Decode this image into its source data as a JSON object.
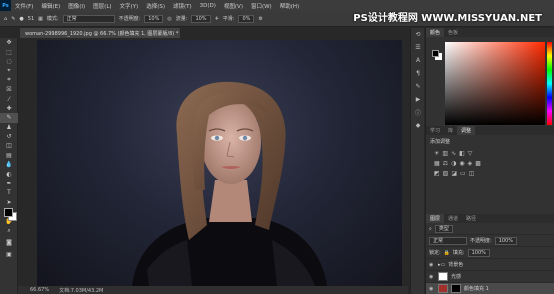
{
  "menu": {
    "logo": "Ps",
    "items": [
      "文件(F)",
      "编辑(E)",
      "图像(I)",
      "图层(L)",
      "文字(Y)",
      "选择(S)",
      "滤镜(T)",
      "3D(D)",
      "视图(V)",
      "窗口(W)",
      "帮助(H)"
    ]
  },
  "watermark": "PS设计教程网 WWW.MISSYUAN.NET",
  "options": {
    "brush_size": "51",
    "mode_label": "模式:",
    "mode_value": "正常",
    "opacity_label": "不透明度:",
    "opacity_value": "10%",
    "flow_label": "流量:",
    "flow_value": "10%",
    "smooth_label": "平滑:",
    "smooth_value": "0%"
  },
  "document": {
    "tab_title": "woman-2998996_1920.jpg @ 66.7% (颜色填充 1, 图层蒙版/8) *",
    "close": "×",
    "zoom": "66.67%",
    "doc_info": "文档:7.03M/43.2M"
  },
  "color_panel": {
    "tabs": [
      "颜色",
      "色板"
    ],
    "fg": "#000000",
    "bg": "#ffffff"
  },
  "adjust_panel": {
    "tabs": [
      "学习",
      "库",
      "调整"
    ],
    "title": "添加调整"
  },
  "layers_panel": {
    "tabs": [
      "图层",
      "通道",
      "路径"
    ],
    "filter_label": "类型",
    "blend_mode": "正常",
    "opacity_label": "不透明度:",
    "opacity_value": "100%",
    "lock_label": "锁定:",
    "fill_label": "填充:",
    "fill_value": "100%",
    "layers": [
      {
        "name": "背景色",
        "type": "group"
      },
      {
        "name": "光感",
        "type": "mask"
      },
      {
        "name": "颜色填充 1",
        "type": "fill",
        "color": "#a0302a"
      }
    ]
  }
}
